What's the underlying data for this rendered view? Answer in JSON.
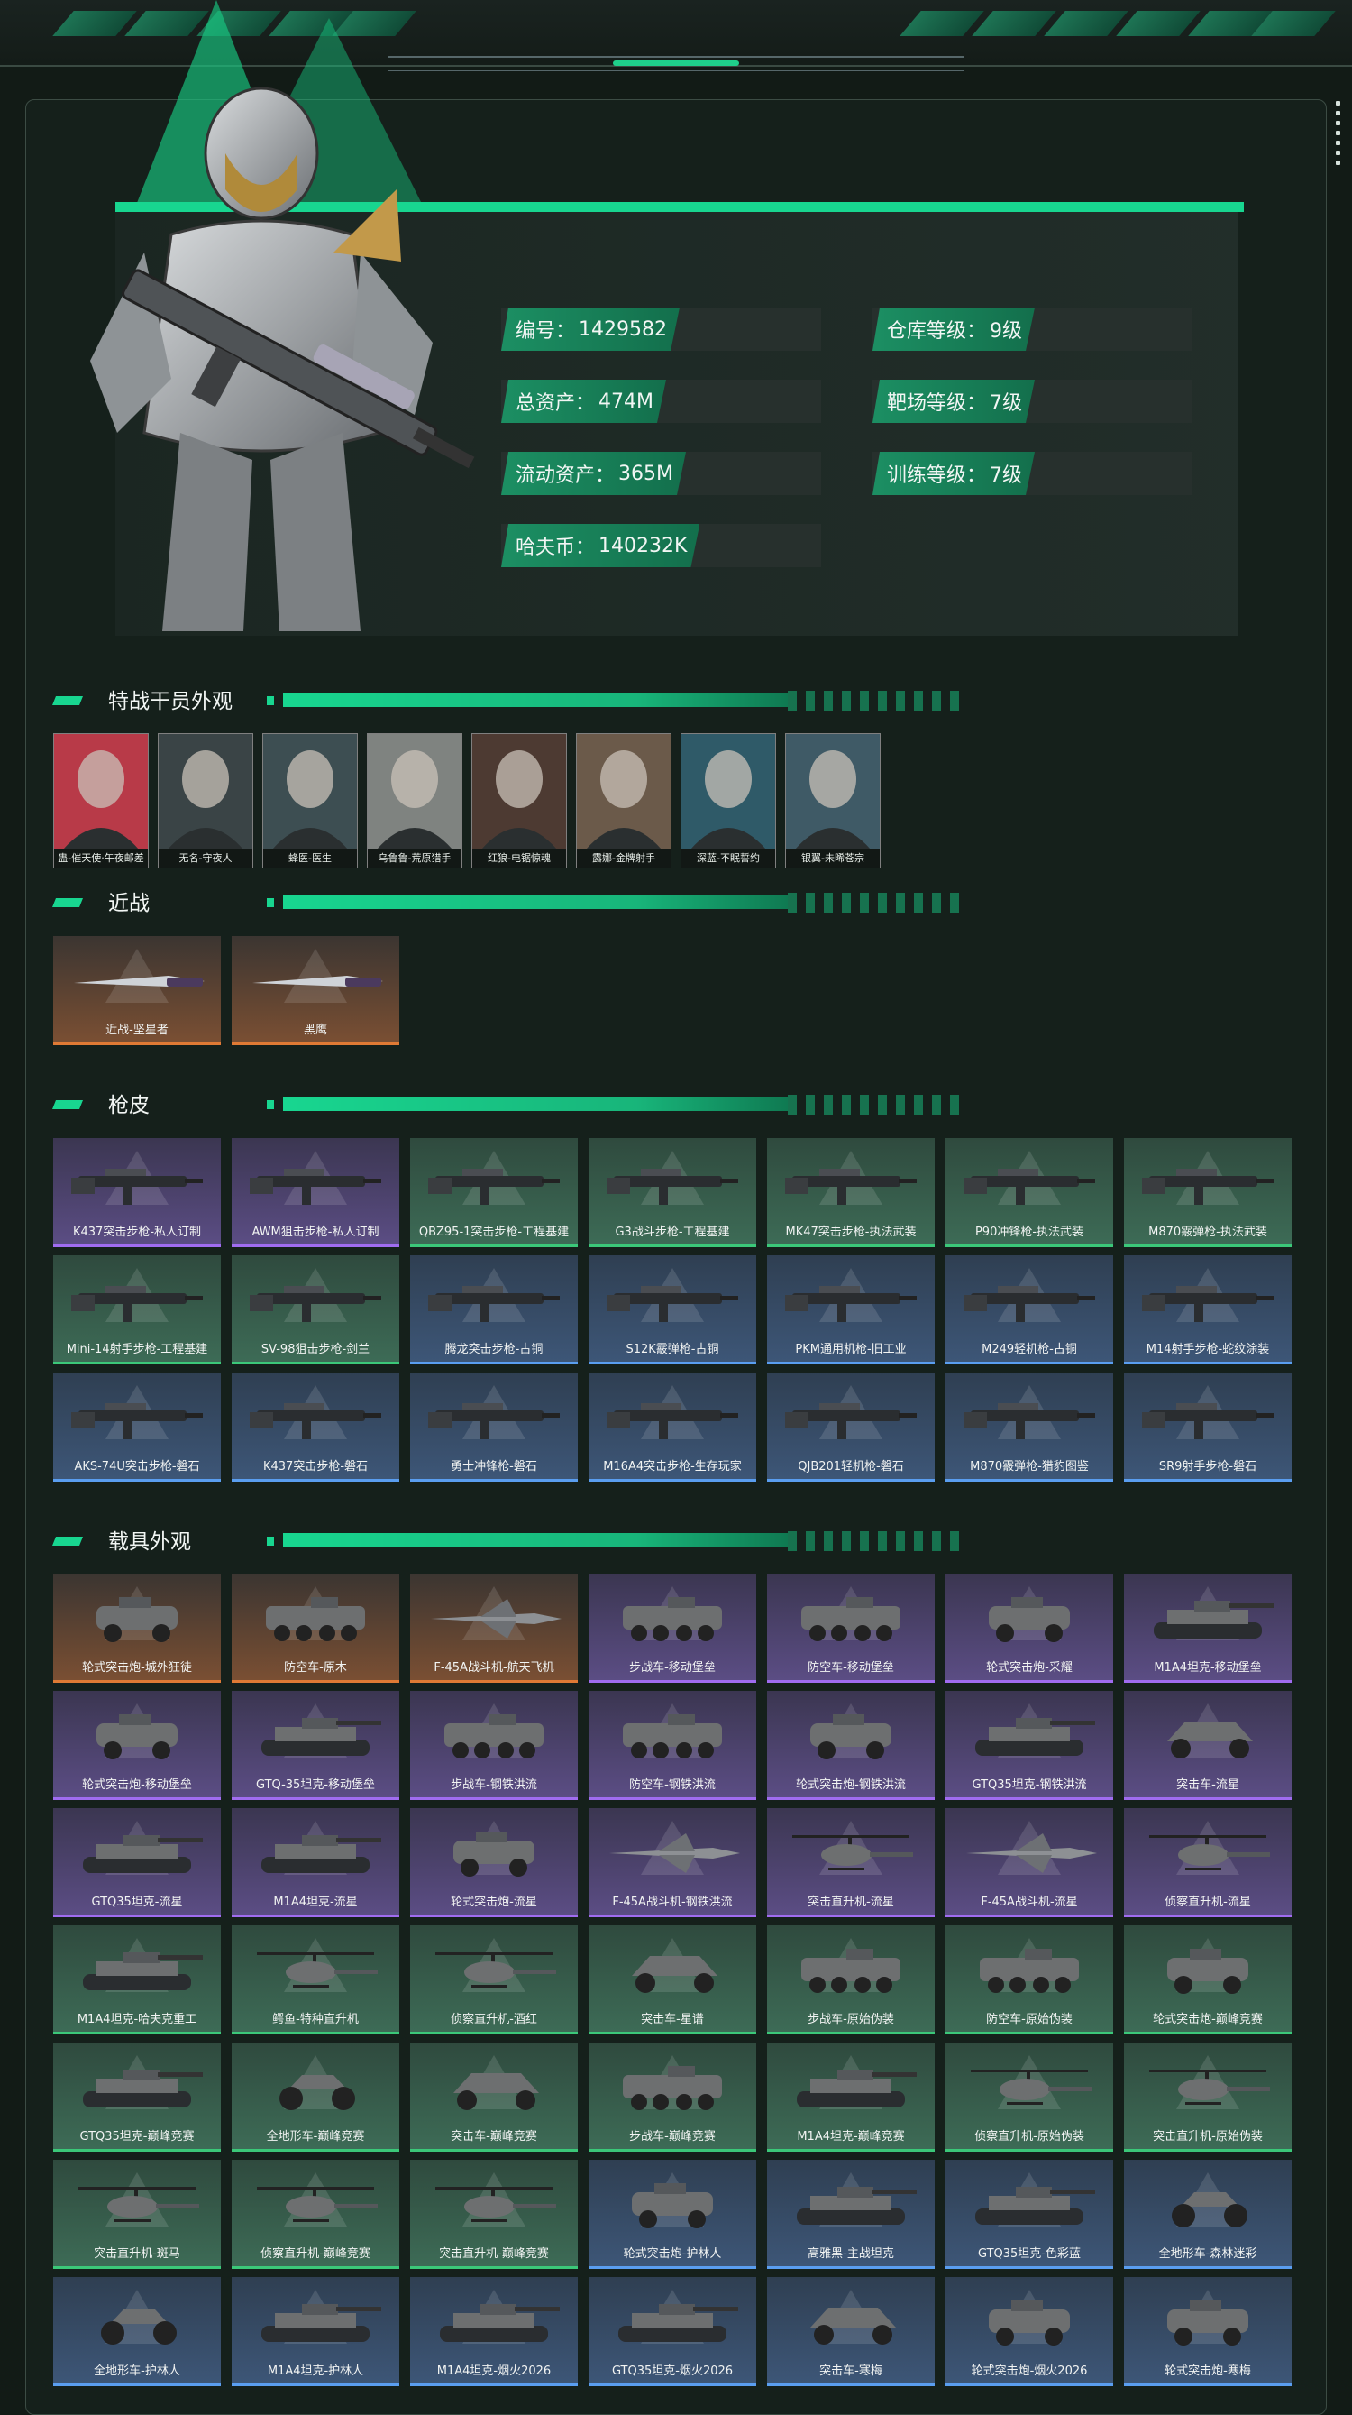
{
  "colors": {
    "accent": "#18d690",
    "orange_rarity": "#e07a35",
    "purple_rarity": "#a06cf0",
    "green_rarity": "#3bc879",
    "blue_rarity": "#5a9ef0"
  },
  "stats": [
    {
      "label": "编号：",
      "value": "1429582"
    },
    {
      "label": "仓库等级：",
      "value": "9级"
    },
    {
      "label": "总资产：",
      "value": "474M"
    },
    {
      "label": "靶场等级：",
      "value": "7级"
    },
    {
      "label": "流动资产：",
      "value": "365M"
    },
    {
      "label": "训练等级：",
      "value": "7级"
    },
    {
      "label": "哈夫币：",
      "value": "140232K"
    }
  ],
  "sections": {
    "operators": "特战干员外观",
    "melee": "近战",
    "gun_skins": "枪皮",
    "vehicles": "载具外观"
  },
  "operators": [
    "蛊-催天使·午夜邮差",
    "无名-守夜人",
    "蜂医-医生",
    "乌鲁鲁-荒原猎手",
    "红狼-电锯惊魂",
    "露娜-金牌射手",
    "深蓝-不眠誓约",
    "银翼-未晞苍宗"
  ],
  "melee": [
    {
      "name": "近战-坚星者",
      "rarity": "orange",
      "icon": "knife-icon"
    },
    {
      "name": "黑鹰",
      "rarity": "orange",
      "icon": "knife-icon"
    }
  ],
  "gun_skins": [
    {
      "name": "K437突击步枪-私人订制",
      "rarity": "purple"
    },
    {
      "name": "AWM狙击步枪-私人订制",
      "rarity": "purple"
    },
    {
      "name": "QBZ95-1突击步枪-工程基建",
      "rarity": "green"
    },
    {
      "name": "G3战斗步枪-工程基建",
      "rarity": "green"
    },
    {
      "name": "MK47突击步枪-执法武装",
      "rarity": "green"
    },
    {
      "name": "P90冲锋枪-执法武装",
      "rarity": "green"
    },
    {
      "name": "M870霰弹枪-执法武装",
      "rarity": "green"
    },
    {
      "name": "Mini-14射手步枪-工程基建",
      "rarity": "green"
    },
    {
      "name": "SV-98狙击步枪-剑兰",
      "rarity": "green"
    },
    {
      "name": "腾龙突击步枪-古铜",
      "rarity": "blue"
    },
    {
      "name": "S12K霰弹枪-古铜",
      "rarity": "blue"
    },
    {
      "name": "PKM通用机枪-旧工业",
      "rarity": "blue"
    },
    {
      "name": "M249轻机枪-古铜",
      "rarity": "blue"
    },
    {
      "name": "M14射手步枪-蛇纹涂装",
      "rarity": "blue"
    },
    {
      "name": "AKS-74U突击步枪-磐石",
      "rarity": "blue"
    },
    {
      "name": "K437突击步枪-磐石",
      "rarity": "blue"
    },
    {
      "name": "勇士冲锋枪-磐石",
      "rarity": "blue"
    },
    {
      "name": "M16A4突击步枪-生存玩家",
      "rarity": "blue"
    },
    {
      "name": "QJB201轻机枪-磐石",
      "rarity": "blue"
    },
    {
      "name": "M870霰弹枪-猎豹图鉴",
      "rarity": "blue"
    },
    {
      "name": "SR9射手步枪-磐石",
      "rarity": "blue"
    }
  ],
  "vehicles": [
    {
      "name": "轮式突击炮-城外狂徒",
      "rarity": "orange",
      "icon": "armored-car-icon"
    },
    {
      "name": "防空车-原木",
      "rarity": "orange",
      "icon": "apc-icon"
    },
    {
      "name": "F-45A战斗机-航天飞机",
      "rarity": "orange",
      "icon": "jet-icon"
    },
    {
      "name": "步战车-移动堡垒",
      "rarity": "purple",
      "icon": "apc-icon"
    },
    {
      "name": "防空车-移动堡垒",
      "rarity": "purple",
      "icon": "apc-icon"
    },
    {
      "name": "轮式突击炮-采耀",
      "rarity": "purple",
      "icon": "armored-car-icon"
    },
    {
      "name": "M1A4坦克-移动堡垒",
      "rarity": "purple",
      "icon": "tank-icon"
    },
    {
      "name": "轮式突击炮-移动堡垒",
      "rarity": "purple",
      "icon": "armored-car-icon"
    },
    {
      "name": "GTQ-35坦克-移动堡垒",
      "rarity": "purple",
      "icon": "tank-icon"
    },
    {
      "name": "步战车-钢铁洪流",
      "rarity": "purple",
      "icon": "apc-icon"
    },
    {
      "name": "防空车-钢铁洪流",
      "rarity": "purple",
      "icon": "apc-icon"
    },
    {
      "name": "轮式突击炮-钢铁洪流",
      "rarity": "purple",
      "icon": "armored-car-icon"
    },
    {
      "name": "GTQ35坦克-钢铁洪流",
      "rarity": "purple",
      "icon": "tank-icon"
    },
    {
      "name": "突击车-流星",
      "rarity": "purple",
      "icon": "buggy-icon"
    },
    {
      "name": "GTQ35坦克-流星",
      "rarity": "purple",
      "icon": "tank-icon"
    },
    {
      "name": "M1A4坦克-流星",
      "rarity": "purple",
      "icon": "tank-icon"
    },
    {
      "name": "轮式突击炮-流星",
      "rarity": "purple",
      "icon": "armored-car-icon"
    },
    {
      "name": "F-45A战斗机-钢铁洪流",
      "rarity": "purple",
      "icon": "jet-icon"
    },
    {
      "name": "突击直升机-流星",
      "rarity": "purple",
      "icon": "helicopter-icon"
    },
    {
      "name": "F-45A战斗机-流星",
      "rarity": "purple",
      "icon": "jet-icon"
    },
    {
      "name": "侦察直升机-流星",
      "rarity": "purple",
      "icon": "helicopter-icon"
    },
    {
      "name": "M1A4坦克-哈夫克重工",
      "rarity": "green",
      "icon": "tank-icon"
    },
    {
      "name": "鳄鱼-特种直升机",
      "rarity": "green",
      "icon": "helicopter-icon"
    },
    {
      "name": "侦察直升机-酒红",
      "rarity": "green",
      "icon": "helicopter-icon"
    },
    {
      "name": "突击车-星谱",
      "rarity": "green",
      "icon": "buggy-icon"
    },
    {
      "name": "步战车-原始伪装",
      "rarity": "green",
      "icon": "apc-icon"
    },
    {
      "name": "防空车-原始伪装",
      "rarity": "green",
      "icon": "apc-icon"
    },
    {
      "name": "轮式突击炮-巅峰竞赛",
      "rarity": "green",
      "icon": "armored-car-icon"
    },
    {
      "name": "GTQ35坦克-巅峰竞赛",
      "rarity": "green",
      "icon": "tank-icon"
    },
    {
      "name": "全地形车-巅峰竞赛",
      "rarity": "green",
      "icon": "atv-icon"
    },
    {
      "name": "突击车-巅峰竞赛",
      "rarity": "green",
      "icon": "buggy-icon"
    },
    {
      "name": "步战车-巅峰竞赛",
      "rarity": "green",
      "icon": "apc-icon"
    },
    {
      "name": "M1A4坦克-巅峰竞赛",
      "rarity": "green",
      "icon": "tank-icon"
    },
    {
      "name": "侦察直升机-原始伪装",
      "rarity": "green",
      "icon": "helicopter-icon"
    },
    {
      "name": "突击直升机-原始伪装",
      "rarity": "green",
      "icon": "helicopter-icon"
    },
    {
      "name": "突击直升机-斑马",
      "rarity": "green",
      "icon": "helicopter-icon"
    },
    {
      "name": "侦察直升机-巅峰竞赛",
      "rarity": "green",
      "icon": "helicopter-icon"
    },
    {
      "name": "突击直升机-巅峰竞赛",
      "rarity": "green",
      "icon": "helicopter-icon"
    },
    {
      "name": "轮式突击炮-护林人",
      "rarity": "blue",
      "icon": "armored-car-icon"
    },
    {
      "name": "高雅黑-主战坦克",
      "rarity": "blue",
      "icon": "tank-icon"
    },
    {
      "name": "GTQ35坦克-色彩蓝",
      "rarity": "blue",
      "icon": "tank-icon"
    },
    {
      "name": "全地形车-森林迷彩",
      "rarity": "blue",
      "icon": "atv-icon"
    },
    {
      "name": "全地形车-护林人",
      "rarity": "blue",
      "icon": "atv-icon"
    },
    {
      "name": "M1A4坦克-护林人",
      "rarity": "blue",
      "icon": "tank-icon"
    },
    {
      "name": "M1A4坦克-烟火2026",
      "rarity": "blue",
      "icon": "tank-icon"
    },
    {
      "name": "GTQ35坦克-烟火2026",
      "rarity": "blue",
      "icon": "tank-icon"
    },
    {
      "name": "突击车-寒梅",
      "rarity": "blue",
      "icon": "buggy-icon"
    },
    {
      "name": "轮式突击炮-烟火2026",
      "rarity": "blue",
      "icon": "armored-car-icon"
    },
    {
      "name": "轮式突击炮-寒梅",
      "rarity": "blue",
      "icon": "armored-car-icon"
    }
  ]
}
